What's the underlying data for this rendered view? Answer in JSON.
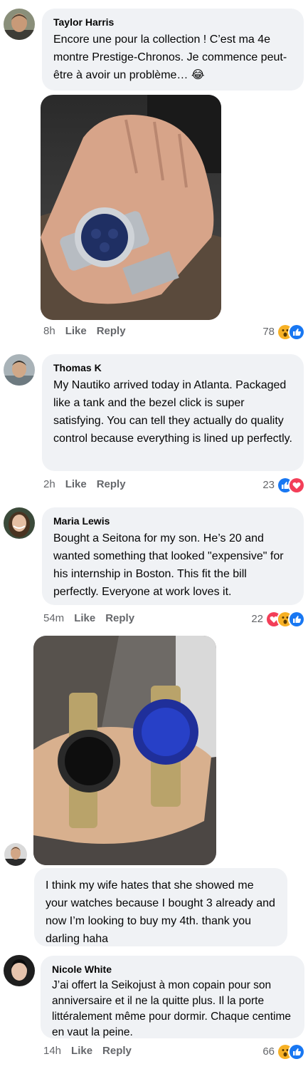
{
  "comments": [
    {
      "author": "Taylor Harris",
      "text": "Encore une pour la collection ! C’est ma 4e montre Prestige-Chronos. Je commence peut-être à avoir un problème…",
      "emoji": "😂",
      "time": "8h",
      "like": "Like",
      "reply": "Reply",
      "reaction_count": "78",
      "reactions": [
        "wow-icon",
        "like-icon"
      ]
    },
    {
      "author": "Thomas K",
      "text": "My Nautiko arrived today in Atlanta. Packaged like a tank and the bezel click is super satisfying. You can tell they actually do quality control because everything is lined up perfectly.",
      "time": "2h",
      "like": "Like",
      "reply": "Reply",
      "reaction_count": "23",
      "reactions": [
        "like-icon",
        "love-icon"
      ]
    },
    {
      "author": "Maria Lewis",
      "text": "Bought a Seitona for my son. He’s 20 and wanted something that looked \"expensive\" for his internship in Boston. This fit the bill perfectly. Everyone at work loves it.",
      "time": "54m",
      "like": "Like",
      "reply": "Reply",
      "reaction_count": "22",
      "reactions": [
        "love-icon",
        "wow-icon",
        "like-icon"
      ]
    },
    {
      "author": "",
      "text": "I think my wife hates that she showed me your watches because I bought 3 already and now I’m looking to buy my 4th. thank you darling haha"
    },
    {
      "author": "Nicole White",
      "text": "J’ai offert la Seikojust à mon copain pour son anniversaire et il ne la quitte plus. Il la porte littéralement même pour dormir. Chaque centime en vaut la peine.",
      "time": "14h",
      "like": "Like",
      "reply": "Reply",
      "reaction_count": "66",
      "reactions": [
        "wow-icon",
        "like-icon"
      ]
    }
  ],
  "colors": {
    "bubble": "#f0f2f5",
    "meta": "#65676b",
    "like_blue": "#1877f2",
    "love_red": "#f33e58",
    "wow_yellow": "#f7b125"
  }
}
